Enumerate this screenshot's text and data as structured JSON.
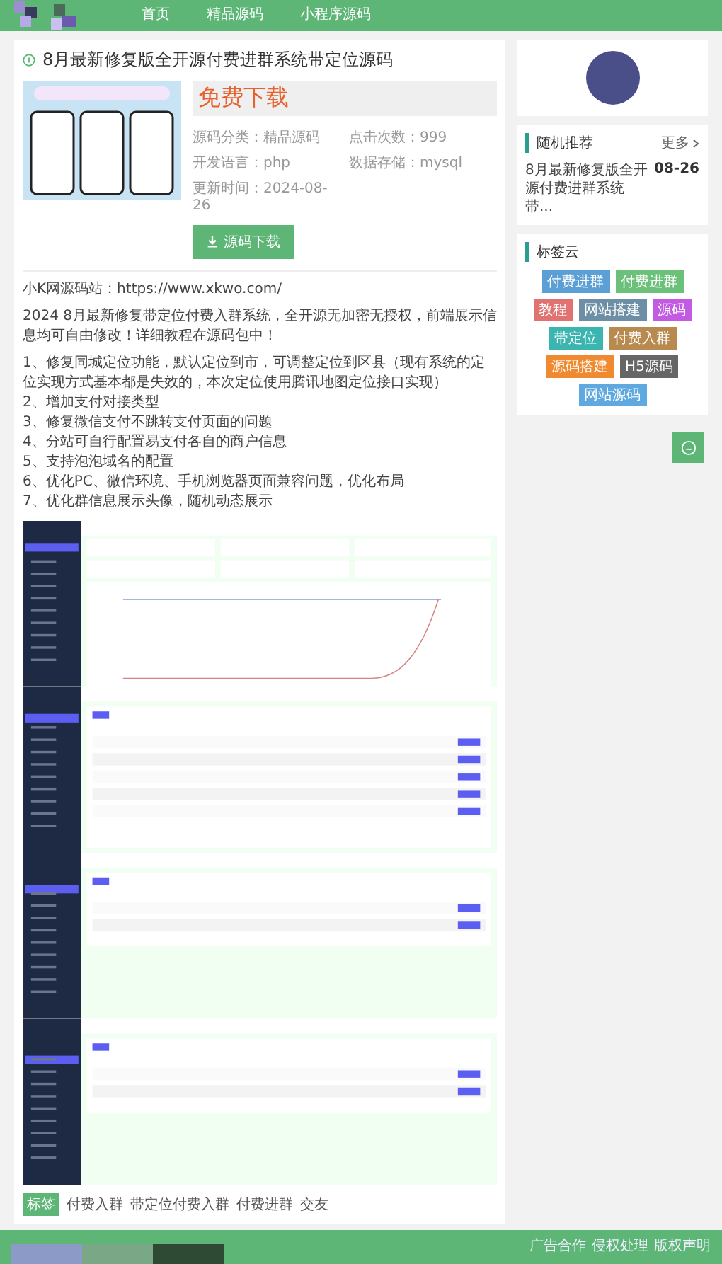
{
  "nav": {
    "items": [
      {
        "label": "首页",
        "selected": false
      },
      {
        "label": "精品源码",
        "selected": false
      },
      {
        "label": "小程序源码",
        "selected": false
      }
    ]
  },
  "article": {
    "title": "8月最新修复版全开源付费进群系统带定位源码",
    "download_banner": "免费下载",
    "meta": [
      {
        "label": "源码分类：",
        "value": "精品源码"
      },
      {
        "label": "点击次数：",
        "value": "999"
      },
      {
        "label": "开发语言：",
        "value": "php"
      },
      {
        "label": "数据存储：",
        "value": "mysql"
      },
      {
        "label": "更新时间：",
        "value": "2024-08-26"
      }
    ],
    "download_button": "源码下载",
    "source_line": "小K网源码站：https://www.xkwo.com/",
    "intro": "2024 8月最新修复带定位付费入群系统，全开源无加密无授权，前端展示信息均可自由修改！详细教程在源码包中！",
    "features": [
      "1、修复同城定位功能，默认定位到市，可调整定位到区县（现有系统的定位实现方式基本都是失效的，本次定位使用腾讯地图定位接口实现）",
      "2、增加支付对接类型",
      "3、修复微信支付不跳转支付页面的问题",
      "4、分站可自行配置易支付各自的商户信息",
      "5、支持泡泡域名的配置",
      "6、优化PC、微信环境、手机浏览器页面兼容问题，优化布局",
      "7、优化群信息展示头像，随机动态展示"
    ],
    "tags_label": "标签",
    "tags": [
      "付费入群",
      "带定位付费入群",
      "付费进群",
      "交友"
    ]
  },
  "sidebar": {
    "random": {
      "title": "随机推荐",
      "more": "更多",
      "items": [
        {
          "title": "8月最新修复版全开源付费进群系统带...",
          "date": "08-26"
        }
      ]
    },
    "tag_cloud": {
      "title": "标签云",
      "tags": [
        {
          "label": "付费进群",
          "color": "#5b9fd4"
        },
        {
          "label": "付费进群",
          "color": "#6cc17a"
        },
        {
          "label": "教程",
          "color": "#e07272"
        },
        {
          "label": "网站搭建",
          "color": "#6d8fa6"
        },
        {
          "label": "源码",
          "color": "#c25ae2"
        },
        {
          "label": "带定位",
          "color": "#3ab5b0"
        },
        {
          "label": "付费入群",
          "color": "#b88a50"
        },
        {
          "label": "源码搭建",
          "color": "#f08a30"
        },
        {
          "label": "H5源码",
          "color": "#666666"
        },
        {
          "label": "网站源码",
          "color": "#5fa8e0"
        }
      ]
    }
  },
  "footer": {
    "links": [
      "广告合作",
      "侵权处理",
      "版权声明"
    ]
  }
}
